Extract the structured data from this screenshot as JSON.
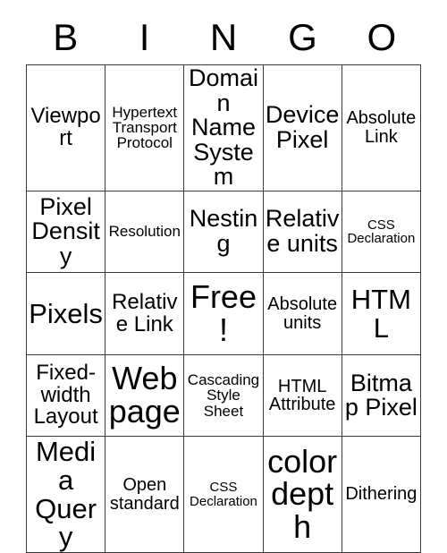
{
  "card": {
    "header_letters": [
      "B",
      "I",
      "N",
      "G",
      "O"
    ],
    "rows": [
      [
        {
          "text": "Viewport",
          "size": "md"
        },
        {
          "text": "Hypertext Transport Protocol",
          "size": "xs"
        },
        {
          "text": "Domain Name System",
          "size": "lg"
        },
        {
          "text": "Device Pixel",
          "size": "lg"
        },
        {
          "text": "Absolute Link",
          "size": "sm"
        }
      ],
      [
        {
          "text": "Pixel Density",
          "size": "lg"
        },
        {
          "text": "Resolution",
          "size": "xs"
        },
        {
          "text": "Nesting",
          "size": "lg"
        },
        {
          "text": "Relative units",
          "size": "lg"
        },
        {
          "text": "CSS Declaration",
          "size": "xxs"
        }
      ],
      [
        {
          "text": "Pixels",
          "size": "xl"
        },
        {
          "text": "Relative Link",
          "size": "md"
        },
        {
          "text": "Free!",
          "size": "huge"
        },
        {
          "text": "Absolute units",
          "size": "sm"
        },
        {
          "text": "HTML",
          "size": "xl"
        }
      ],
      [
        {
          "text": "Fixed-width Layout",
          "size": "md"
        },
        {
          "text": "Web page",
          "size": "huge"
        },
        {
          "text": "Cascading Style Sheet",
          "size": "xs"
        },
        {
          "text": "HTML Attribute",
          "size": "sm"
        },
        {
          "text": "Bitmap Pixel",
          "size": "lg"
        }
      ],
      [
        {
          "text": "Media Query",
          "size": "xl"
        },
        {
          "text": "Open standard",
          "size": "sm"
        },
        {
          "text": "CSS Declaration",
          "size": "xxs"
        },
        {
          "text": "color depth",
          "size": "huge"
        },
        {
          "text": "Dithering",
          "size": "sm"
        }
      ]
    ],
    "colors": {
      "border": "#3a3a3a",
      "background": "#ffffff",
      "text": "#000000"
    }
  }
}
